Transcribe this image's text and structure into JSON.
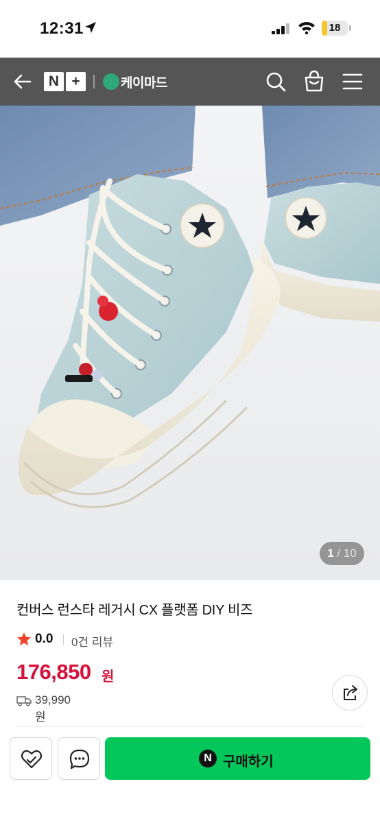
{
  "status_bar": {
    "time": "12:31",
    "battery_level": "18",
    "battery_fraction": 0.18,
    "icons": [
      "location-arrow-icon",
      "cellular-signal-icon",
      "wifi-icon",
      "battery-icon"
    ]
  },
  "nav": {
    "back_icon": "back-arrow-icon",
    "platform_logo": {
      "left": "N",
      "right": "+"
    },
    "store_name": "케이마드",
    "icons": [
      "search-icon",
      "shopping-bag-icon",
      "hamburger-menu-icon"
    ]
  },
  "gallery": {
    "current": "1",
    "separator": " / ",
    "total": "10"
  },
  "product": {
    "title": "컨버스 런스타 레거시 CX 플랫폼 DIY 비즈",
    "rating": "0.0",
    "review_count": "0건 리뷰",
    "price": "176,850",
    "price_unit": "원",
    "shipping_fee": "39,990원"
  },
  "actions": {
    "share_icon": "share-icon",
    "wish_icon": "heart-icon",
    "chat_icon": "chat-bubble-icon",
    "buy_badge": "N",
    "buy_label": "구매하기"
  },
  "colors": {
    "price": "#d6103a",
    "buy_button": "#03c75a",
    "rating_star": "#f0472a",
    "store_logo": "#2fa87a"
  }
}
